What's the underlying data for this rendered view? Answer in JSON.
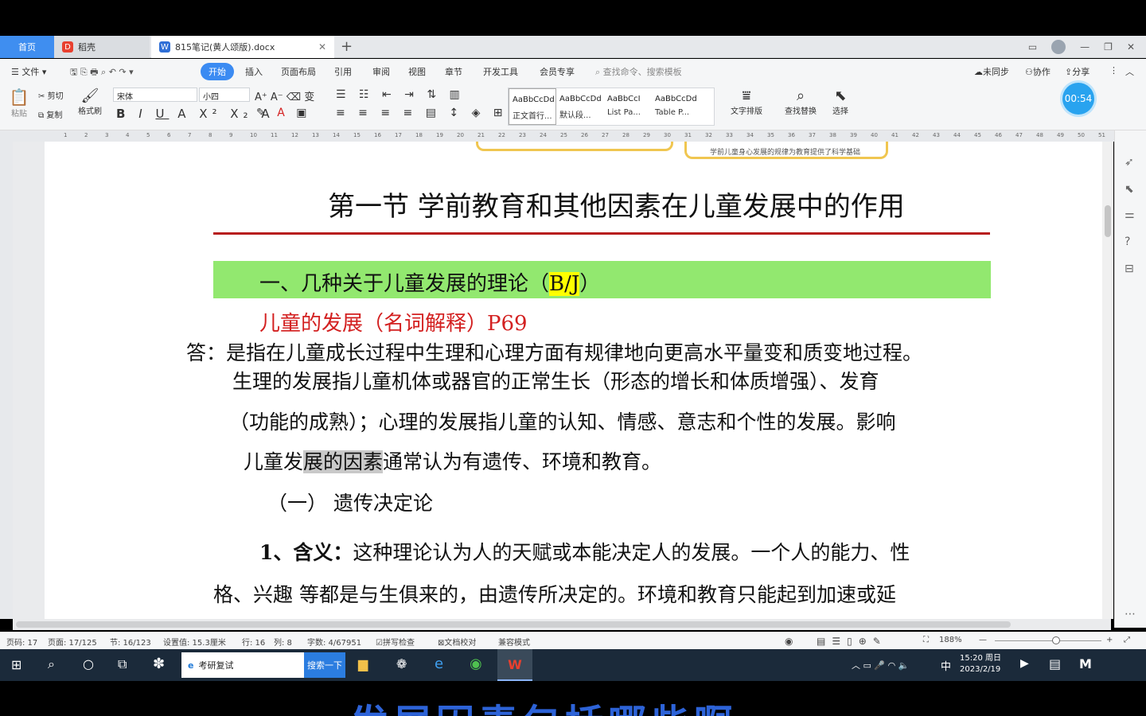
{
  "tabs": {
    "home": "首页",
    "daoke": "稻壳",
    "doc": "815笔记(黄人颂版).docx"
  },
  "menu": {
    "file": "文件",
    "items": [
      "开始",
      "插入",
      "页面布局",
      "引用",
      "审阅",
      "视图",
      "章节",
      "开发工具",
      "会员专享"
    ],
    "search_placeholder": "查找命令、搜索模板",
    "unsync": "未同步",
    "collab": "协作",
    "share": "分享"
  },
  "ribbon": {
    "paste": "粘贴",
    "cut": "剪切",
    "copy": "复制",
    "format_painter": "格式刷",
    "font_name": "宋体",
    "font_size": "小四",
    "styles": [
      {
        "preview": "AaBbCcDd",
        "name": "正文首行..."
      },
      {
        "preview": "AaBbCcDd",
        "name": "默认段..."
      },
      {
        "preview": "AaBbCcI",
        "name": "List Pa..."
      },
      {
        "preview": "AaBbCcDd",
        "name": "Table P..."
      }
    ],
    "text_layout": "文字排版",
    "find_replace": "查找替换",
    "select": "选择"
  },
  "timer": "00:54",
  "document": {
    "deco_text": "学前儿童身心发展的规律为教育提供了科学基础",
    "title": "第一节  学前教育和其他因素在儿童发展中的作用",
    "section_heading_pre": "一、几种关于儿童发展的理论（",
    "section_heading_mark": "B/J",
    "section_heading_post": "）",
    "term_heading": "儿童的发展（名词解释）P69",
    "answer_line1": "答：是指在儿童成长过程中生理和心理方面有规律地向更高水平量变和质变地过程。",
    "answer_line2": "生理的发展指儿童机体或器官的正常生长（形态的增长和体质增强）、发育",
    "answer_line3": "（功能的成熟）；心理的发展指儿童的认知、情感、意志和个性的发展。影响",
    "answer_line4_pre": "儿童发",
    "answer_line4_sel": "展的因素",
    "answer_line4_post": "通常认为有遗传、环境和教育。",
    "sub_heading": "（一）  遗传决定论",
    "point1_label": "1、含义：",
    "point1_line1": "这种理论认为人的天赋或本能决定人的发展。一个人的能力、性",
    "point1_line2": "格、兴趣  等都是与生俱来的，由遗传所决定的。环境和教育只能起到加速或延"
  },
  "status": {
    "page_num": "页码: 17",
    "pages": "页面: 17/125",
    "section": "节: 16/123",
    "setting": "设置值: 15.3厘米",
    "row": "行: 16",
    "col": "列: 8",
    "words": "字数: 4/67951",
    "spell": "拼写检查",
    "proof": "文档校对",
    "compat": "兼容模式",
    "zoom": "188%"
  },
  "taskbar": {
    "search_text": "考研复试",
    "search_btn": "搜索一下",
    "ime": "中",
    "time": "15:20 周日",
    "date": "2023/2/19"
  },
  "subtitle": "发展因素包括哪些啊"
}
